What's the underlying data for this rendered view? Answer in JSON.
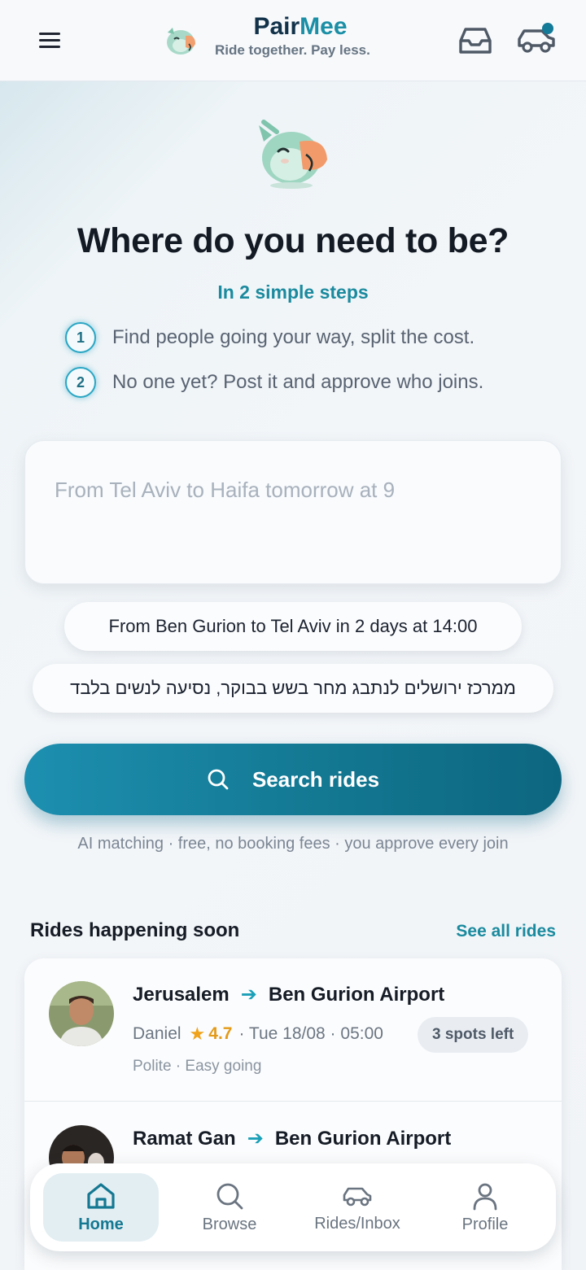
{
  "header": {
    "brand_part1": "Pair",
    "brand_part2": "Mee",
    "tagline": "Ride together. Pay less.",
    "icons": [
      "menu-icon",
      "parrot-logo-icon",
      "inbox-icon",
      "car-icon"
    ]
  },
  "hero": {
    "headline": "Where do you need to be?",
    "steps_title": "In 2 simple steps",
    "steps": [
      {
        "num": "1",
        "text": "Find people going your way, split the cost."
      },
      {
        "num": "2",
        "text": "No one yet? Post it and approve who joins."
      }
    ]
  },
  "search": {
    "placeholder": "From Tel Aviv to Haifa tomorrow at 9",
    "value": "",
    "suggestions": [
      "From Ben Gurion to Tel Aviv in 2 days at 14:00",
      "ממרכז ירושלים לנתבג מחר בשש בבוקר, נסיעה לנשים בלבד"
    ],
    "button_label": "Search rides",
    "fine_print": "AI matching · free, no booking fees · you approve every join"
  },
  "rides_section": {
    "title": "Rides happening soon",
    "see_all": "See all rides",
    "rides": [
      {
        "from": "Jerusalem",
        "to": "Ben Gurion Airport",
        "driver": "Daniel",
        "rating": "4.7",
        "when": "· Tue 18/08 · 05:00",
        "spots": "3 spots left",
        "tags": "Polite · Easy going"
      },
      {
        "from": "Ramat Gan",
        "to": "Ben Gurion Airport"
      }
    ]
  },
  "bottom_nav": {
    "items": [
      {
        "label": "Home",
        "icon": "home-icon",
        "active": true
      },
      {
        "label": "Browse",
        "icon": "search-icon",
        "active": false
      },
      {
        "label": "Rides/Inbox",
        "icon": "car-icon",
        "active": false
      },
      {
        "label": "Profile",
        "icon": "user-icon",
        "active": false
      }
    ]
  },
  "colors": {
    "brand_dark": "#12324a",
    "accent": "#1a8a9e",
    "button": "#137892",
    "rating": "#f0a21a"
  }
}
